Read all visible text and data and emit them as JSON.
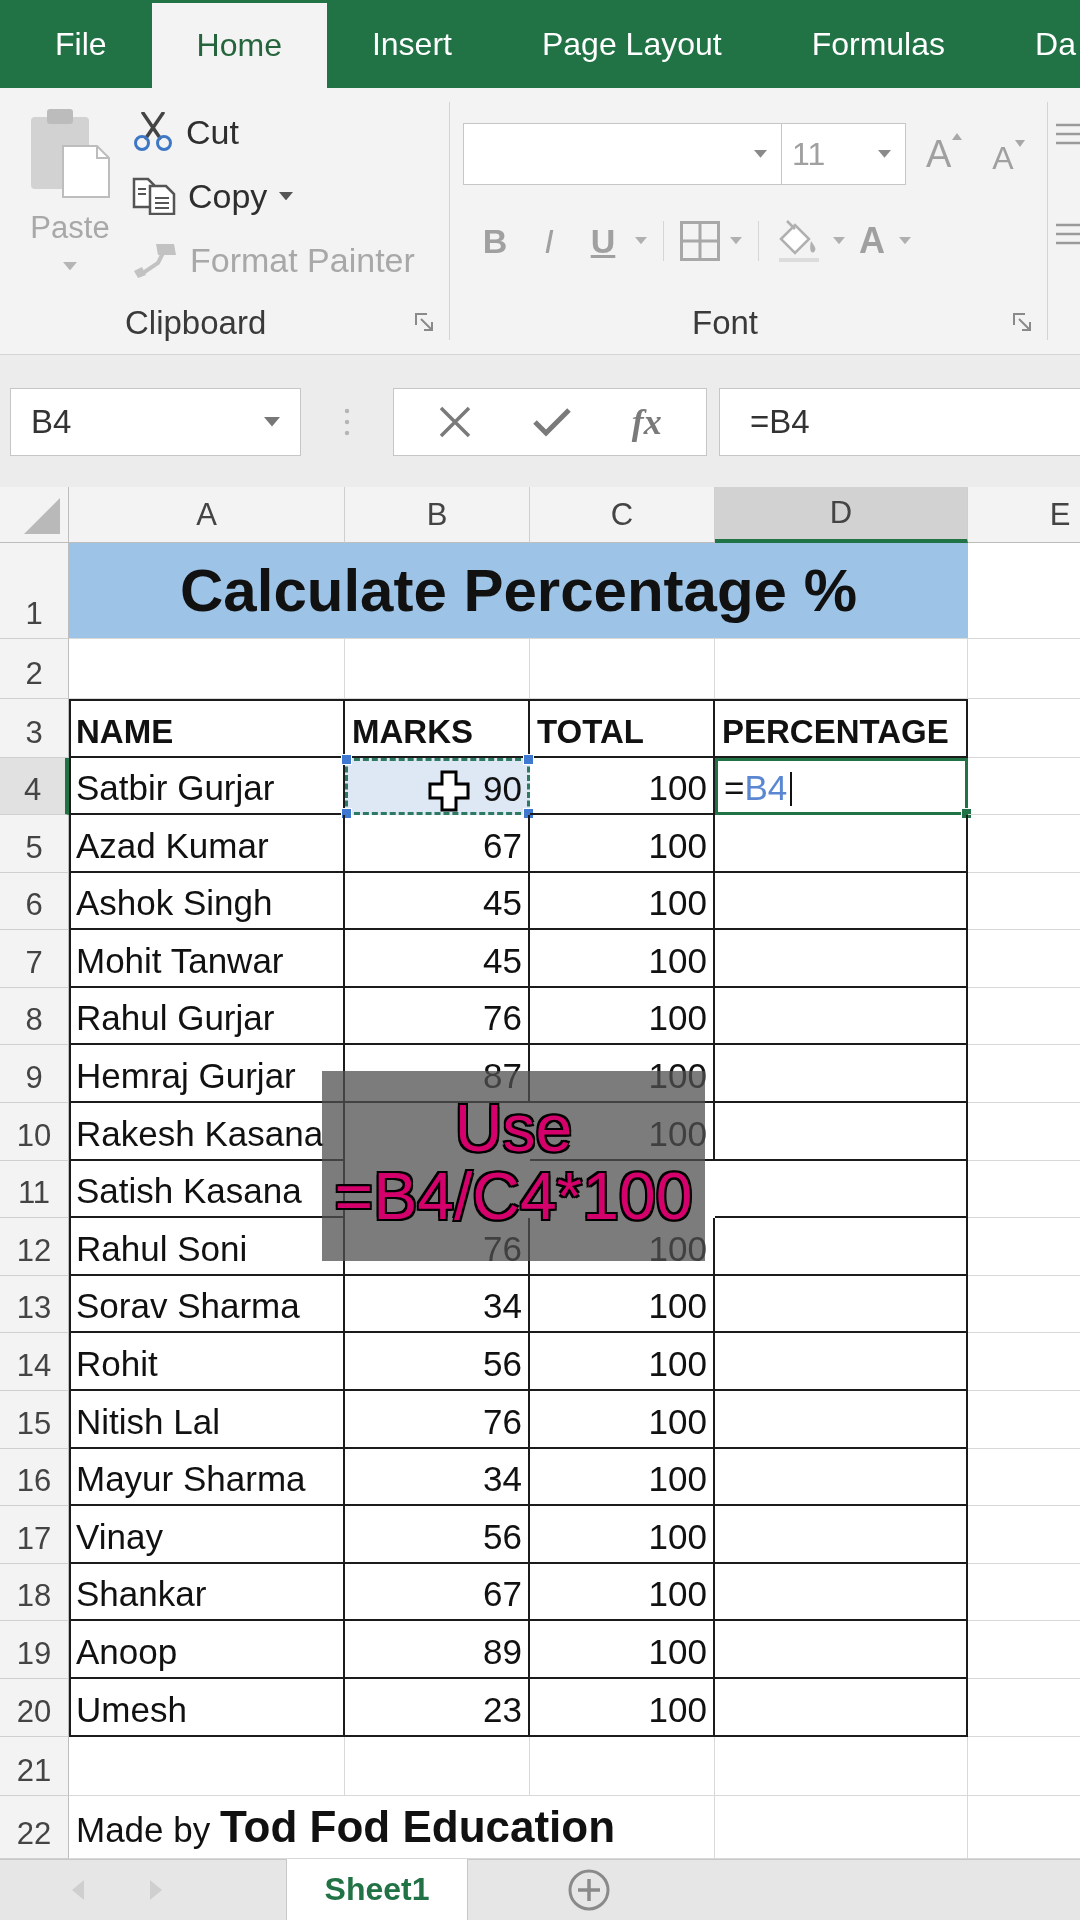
{
  "tabs": [
    {
      "label": "File",
      "selected": false
    },
    {
      "label": "Home",
      "selected": true
    },
    {
      "label": "Insert",
      "selected": false
    },
    {
      "label": "Page Layout",
      "selected": false
    },
    {
      "label": "Formulas",
      "selected": false
    },
    {
      "label": "Da",
      "selected": false
    }
  ],
  "clipboard": {
    "title": "Clipboard",
    "paste": {
      "label": "Paste",
      "disabled": true
    },
    "items": [
      {
        "kind": "cut",
        "label": "Cut",
        "disabled": false,
        "dropdown": false
      },
      {
        "kind": "copy",
        "label": "Copy",
        "disabled": false,
        "dropdown": true
      },
      {
        "kind": "format_painter",
        "label": "Format Painter",
        "disabled": true,
        "dropdown": false
      }
    ]
  },
  "font": {
    "title": "Font",
    "disabled": true,
    "size": "11",
    "size_buttons": [
      {
        "kind": "grow",
        "label": "A"
      },
      {
        "kind": "shrink",
        "label": "A"
      }
    ],
    "style_buttons": [
      {
        "kind": "bold",
        "label": "B",
        "dropdown": false
      },
      {
        "kind": "italic",
        "label": "I",
        "dropdown": false
      },
      {
        "kind": "underline",
        "label": "U",
        "dropdown": true
      }
    ],
    "color_button": {
      "label": "A"
    }
  },
  "formula_bar": {
    "name_box": "B4",
    "function_label": "fx",
    "formula": "=B4"
  },
  "sheet": {
    "columns": [
      {
        "label": "A",
        "selected": false
      },
      {
        "label": "B",
        "selected": false
      },
      {
        "label": "C",
        "selected": false
      },
      {
        "label": "D",
        "selected": true
      },
      {
        "label": "E",
        "selected": false
      }
    ],
    "rows": [
      {
        "number": "1",
        "selected": false,
        "kind": "title",
        "text": "Calculate Percentage %"
      },
      {
        "number": "2",
        "selected": false,
        "kind": "blank"
      },
      {
        "number": "3",
        "selected": false,
        "kind": "header",
        "cells": [
          "NAME",
          "MARKS",
          "TOTAL",
          "PERCENTAGE"
        ]
      },
      {
        "number": "4",
        "selected": true,
        "kind": "editing",
        "name": "Satbir Gurjar",
        "marks": "90",
        "total": "100",
        "formula": {
          "sign": "=",
          "reference": "B4"
        }
      },
      {
        "number": "5",
        "selected": false,
        "kind": "data",
        "name": "Azad Kumar",
        "marks": "67",
        "total": "100"
      },
      {
        "number": "6",
        "selected": false,
        "kind": "data",
        "name": "Ashok Singh",
        "marks": "45",
        "total": "100"
      },
      {
        "number": "7",
        "selected": false,
        "kind": "data",
        "name": "Mohit Tanwar",
        "marks": "45",
        "total": "100"
      },
      {
        "number": "8",
        "selected": false,
        "kind": "data",
        "name": "Rahul Gurjar",
        "marks": "76",
        "total": "100"
      },
      {
        "number": "9",
        "selected": false,
        "kind": "data",
        "name": "Hemraj Gurjar",
        "marks": "87",
        "total": "100"
      },
      {
        "number": "10",
        "selected": false,
        "kind": "data",
        "name": "Rakesh Kasana",
        "total": "100"
      },
      {
        "number": "11",
        "selected": false,
        "kind": "data",
        "name": "Satish Kasana"
      },
      {
        "number": "12",
        "selected": false,
        "kind": "data",
        "name": "Rahul Soni",
        "marks": "76",
        "total": "100"
      },
      {
        "number": "13",
        "selected": false,
        "kind": "data",
        "name": "Sorav Sharma",
        "marks": "34",
        "total": "100"
      },
      {
        "number": "14",
        "selected": false,
        "kind": "data",
        "name": "Rohit",
        "marks": "56",
        "total": "100"
      },
      {
        "number": "15",
        "selected": false,
        "kind": "data",
        "name": "Nitish Lal",
        "marks": "76",
        "total": "100"
      },
      {
        "number": "16",
        "selected": false,
        "kind": "data",
        "name": "Mayur Sharma",
        "marks": "34",
        "total": "100"
      },
      {
        "number": "17",
        "selected": false,
        "kind": "data",
        "name": "Vinay",
        "marks": "56",
        "total": "100"
      },
      {
        "number": "18",
        "selected": false,
        "kind": "data",
        "name": "Shankar",
        "marks": "67",
        "total": "100"
      },
      {
        "number": "19",
        "selected": false,
        "kind": "data",
        "name": "Anoop",
        "marks": "89",
        "total": "100"
      },
      {
        "number": "20",
        "selected": false,
        "kind": "data",
        "name": "Umesh",
        "marks": "23",
        "total": "100"
      },
      {
        "number": "21",
        "selected": false,
        "kind": "blank"
      },
      {
        "number": "22",
        "selected": false,
        "kind": "note",
        "text": "Made by **Tod Fod Education**"
      }
    ]
  },
  "caption": {
    "lines": [
      "Use",
      "=B4/C4*100"
    ]
  },
  "sheet_tabs": [
    {
      "label": "Sheet1",
      "selected": true
    }
  ]
}
